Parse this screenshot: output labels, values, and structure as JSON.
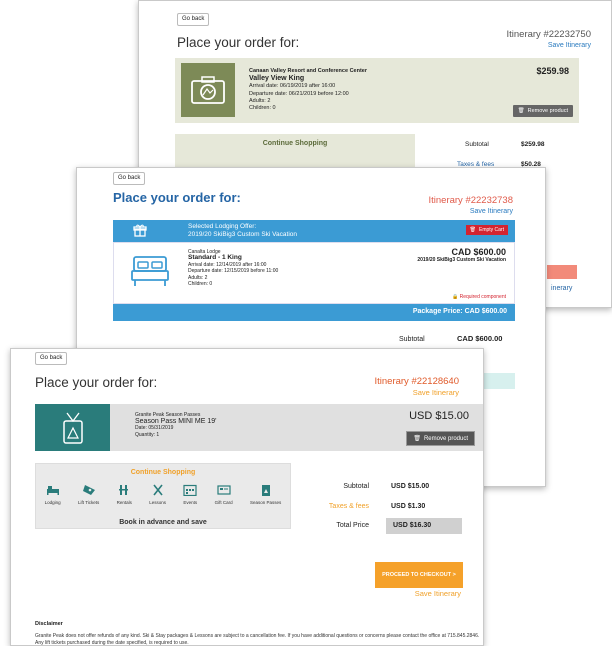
{
  "cards": {
    "c1": {
      "go_back": "Go back",
      "title": "Place your order for:",
      "itinerary": "Itinerary #22232750",
      "save_itinerary": "Save Itinerary",
      "resort": "Canaan Valley Resort and Conference Center",
      "room": "Valley View King",
      "arrival": "Arrival date: 06/19/2019 after 16:00",
      "departure": "Departure date: 06/21/2019 before 12:00",
      "adults": "Adults: 2",
      "children": "Children: 0",
      "price": "$259.98",
      "remove": "Remove product",
      "continue_shopping": "Continue Shopping",
      "subtotal_label": "Subtotal",
      "subtotal_value": "$259.98",
      "taxes_label": "Taxes & fees",
      "taxes_value": "$50.28",
      "cut_right_label": "inerary"
    },
    "c2": {
      "go_back": "Go back",
      "title": "Place your order for:",
      "itinerary": "Itinerary #22232738",
      "save_itinerary": "Save Itinerary",
      "offer_line1": "Selected Lodging Offer:",
      "offer_line2": "2019/20 SkiBig3 Custom Ski Vacation",
      "empty_cart": "Empty Cart",
      "lodge": "Canalta Lodge",
      "room": "Standard - 1 King",
      "arrival": "Arrival date: 12/14/2019 after 16:00",
      "departure": "Departure date: 12/15/2019 before 11:00",
      "adults": "Adults: 2",
      "children": "Children: 0",
      "price": "CAD $600.00",
      "package_name": "2019/20 SkiBig3 Custom Ski Vacation",
      "required": "Required component",
      "package_price": "Package Price: CAD $600.00",
      "subtotal_label": "Subtotal",
      "subtotal_value": "CAD $600.00"
    },
    "c3": {
      "go_back": "Go back",
      "title": "Place your order for:",
      "itinerary": "Itinerary #22128640",
      "save_itinerary": "Save Itinerary",
      "product_group": "Granite Peak Season Passes",
      "product_name": "Season Pass MINI ME 19'",
      "date": "Date: 05/31/2019",
      "quantity": "Quantity: 1",
      "price": "USD $15.00",
      "remove": "Remove product",
      "continue_shopping": "Continue Shopping",
      "items": [
        "Lodging",
        "Lift Tickets",
        "Rentals",
        "Lessons",
        "Events",
        "Gift Card",
        "Season Passes"
      ],
      "book_advance": "Book in advance and save",
      "subtotal_label": "Subtotal",
      "subtotal_value": "USD $15.00",
      "taxes_label": "Taxes & fees",
      "taxes_value": "USD $1.30",
      "total_label": "Total Price",
      "total_value": "USD $16.30",
      "checkout": "PROCEED TO CHECKOUT >",
      "save_itinerary_bottom": "Save Itinerary",
      "disclaimer_title": "Disclaimer",
      "disclaimer_text": "Granite Peak does not offer refunds of any kind. Ski & Stay packages & Lessons are subject to a cancellation fee. If you have additional questions or concerns please contact the office at 715.845.2846. Any lift tickets purchased during the date specified, is required to use."
    }
  },
  "colors": {
    "c1_accent": "#7d8a57",
    "c2_accent": "#3b9bd4",
    "c3_accent": "#f5a12a",
    "c3_thumb": "#2a7c7b"
  }
}
